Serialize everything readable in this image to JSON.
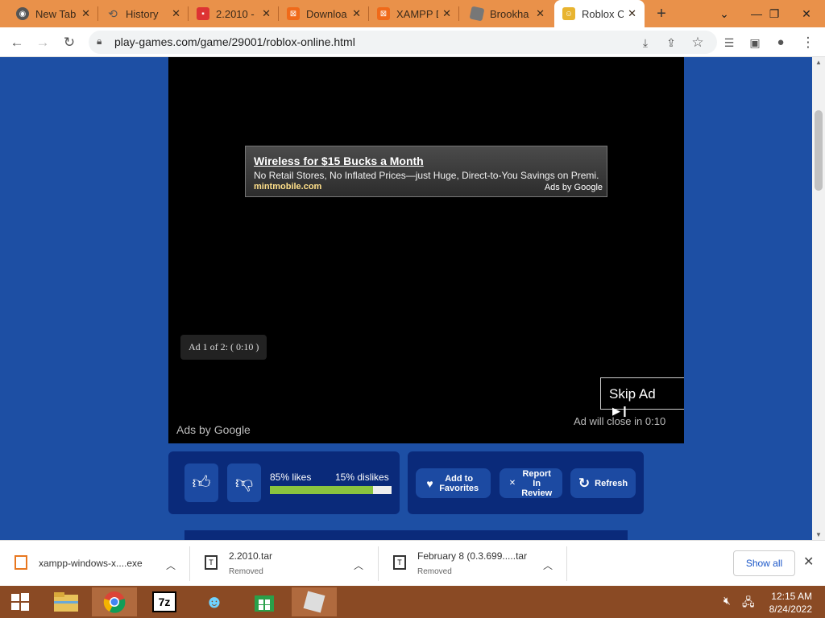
{
  "tabs": [
    {
      "label": "New Tab",
      "icon": "chrome-icon"
    },
    {
      "label": "History",
      "icon": "history-icon"
    },
    {
      "label": "2.2010 -",
      "icon": "app-icon"
    },
    {
      "label": "Downloa",
      "icon": "xampp-icon"
    },
    {
      "label": "XAMPP D",
      "icon": "xampp-icon"
    },
    {
      "label": "Brookha",
      "icon": "roblox-icon"
    },
    {
      "label": "Roblox C",
      "icon": "game-icon",
      "active": true
    }
  ],
  "toolbar": {
    "url": "play-games.com/game/29001/roblox-online.html"
  },
  "ad": {
    "title": "Wireless for $15 Bucks a Month",
    "description": "No Retail Stores, No Inflated Prices—just Huge, Direct-to-You Savings on Premi...",
    "source": "mintmobile.com",
    "ads_by": "Ads by Google",
    "counter": "Ad 1 of 2: ( 0:10 )",
    "skip": "Skip Ad",
    "close_note": "Ad will close in 0:10",
    "ads_by_footer": "Ads by Google"
  },
  "rating": {
    "likes": "85% likes",
    "dislikes": "15% dislikes",
    "like_fraction": 0.85
  },
  "actions": {
    "favorites": "Add to Favorites",
    "report": "Report In Review",
    "refresh": "Refresh"
  },
  "downloads": [
    {
      "name": "xampp-windows-x....exe",
      "status": ""
    },
    {
      "name": "2.2010.tar",
      "status": "Removed"
    },
    {
      "name": "February 8 (0.3.699.....tar",
      "status": "Removed"
    }
  ],
  "downloads_show_all": "Show all",
  "clock": {
    "time": "12:15 AM",
    "date": "8/24/2022"
  },
  "colors": {
    "tabstrip": "#e9914a",
    "page_bg": "#1d4fa4",
    "taskbar": "#8a4a24",
    "like_bar": "#8ac43f"
  }
}
